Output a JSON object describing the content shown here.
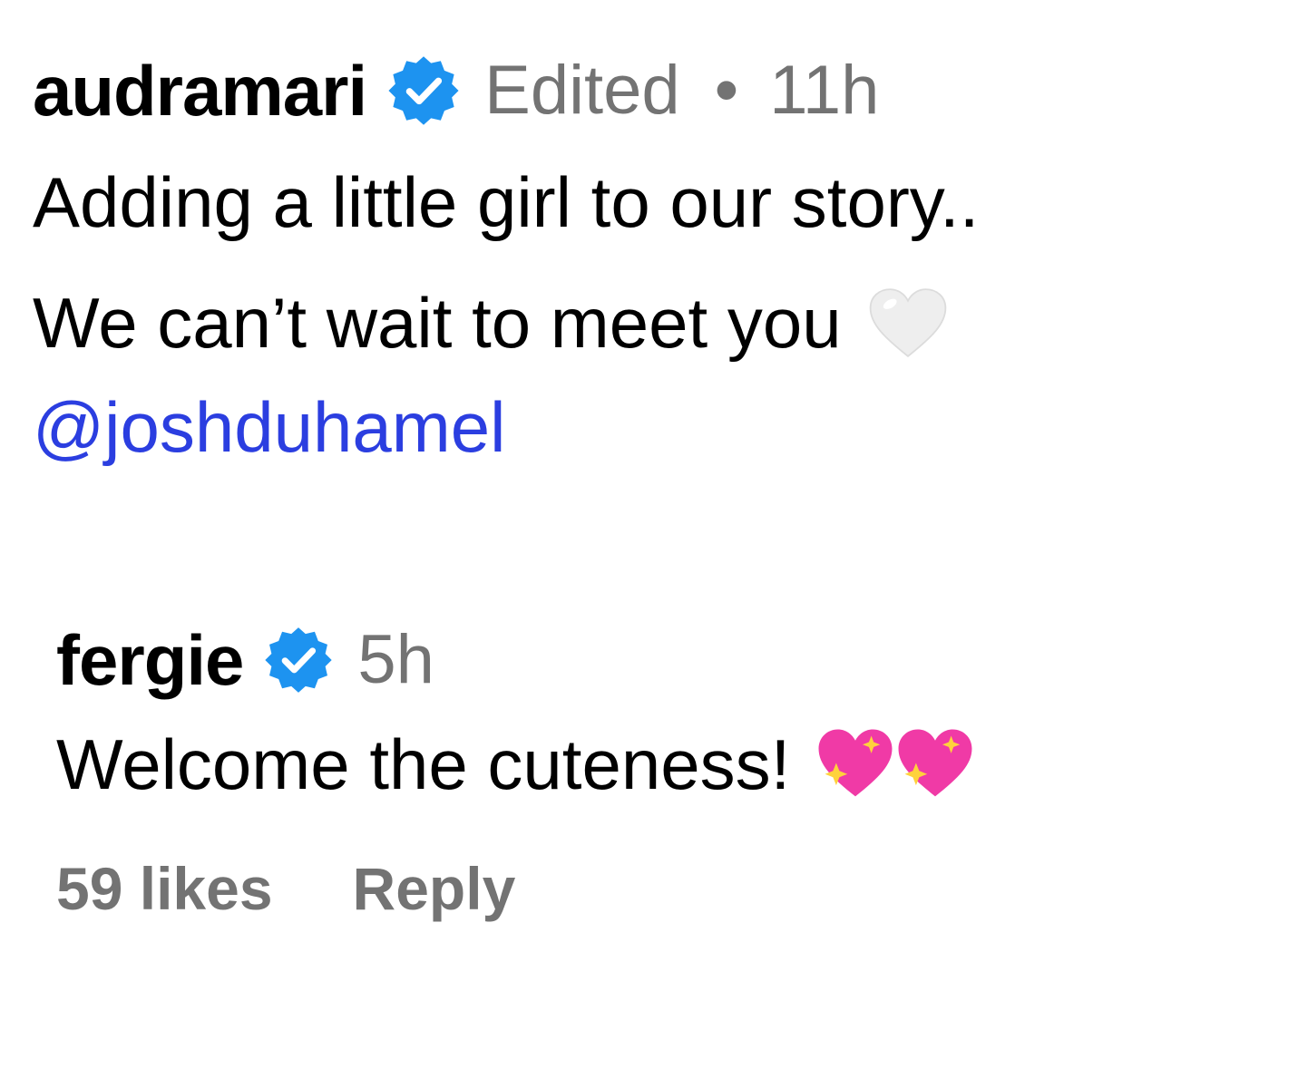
{
  "post": {
    "username": "audramari",
    "verified_icon": "verified-badge-icon",
    "edited_label": "Edited",
    "separator": "•",
    "time": "11h",
    "line1": "Adding a little girl to our story..",
    "line2": "We can’t wait to meet you",
    "line2_emoji": "white-heart-icon",
    "mention": "@joshduhamel"
  },
  "comment": {
    "username": "fergie",
    "verified_icon": "verified-badge-icon",
    "time": "5h",
    "text": "Welcome the cuteness!",
    "emojis": [
      "sparkling-heart-icon",
      "sparkling-heart-icon"
    ],
    "likes_label": "59 likes",
    "reply_label": "Reply"
  },
  "colors": {
    "text": "#000000",
    "meta": "#737373",
    "actions": "#737373",
    "mention": "#2b3ee0",
    "verified": "#1d93f0",
    "pink_heart": "#f03aa6",
    "white_heart": "#eeeeee",
    "sparkle": "#ffd23c"
  }
}
